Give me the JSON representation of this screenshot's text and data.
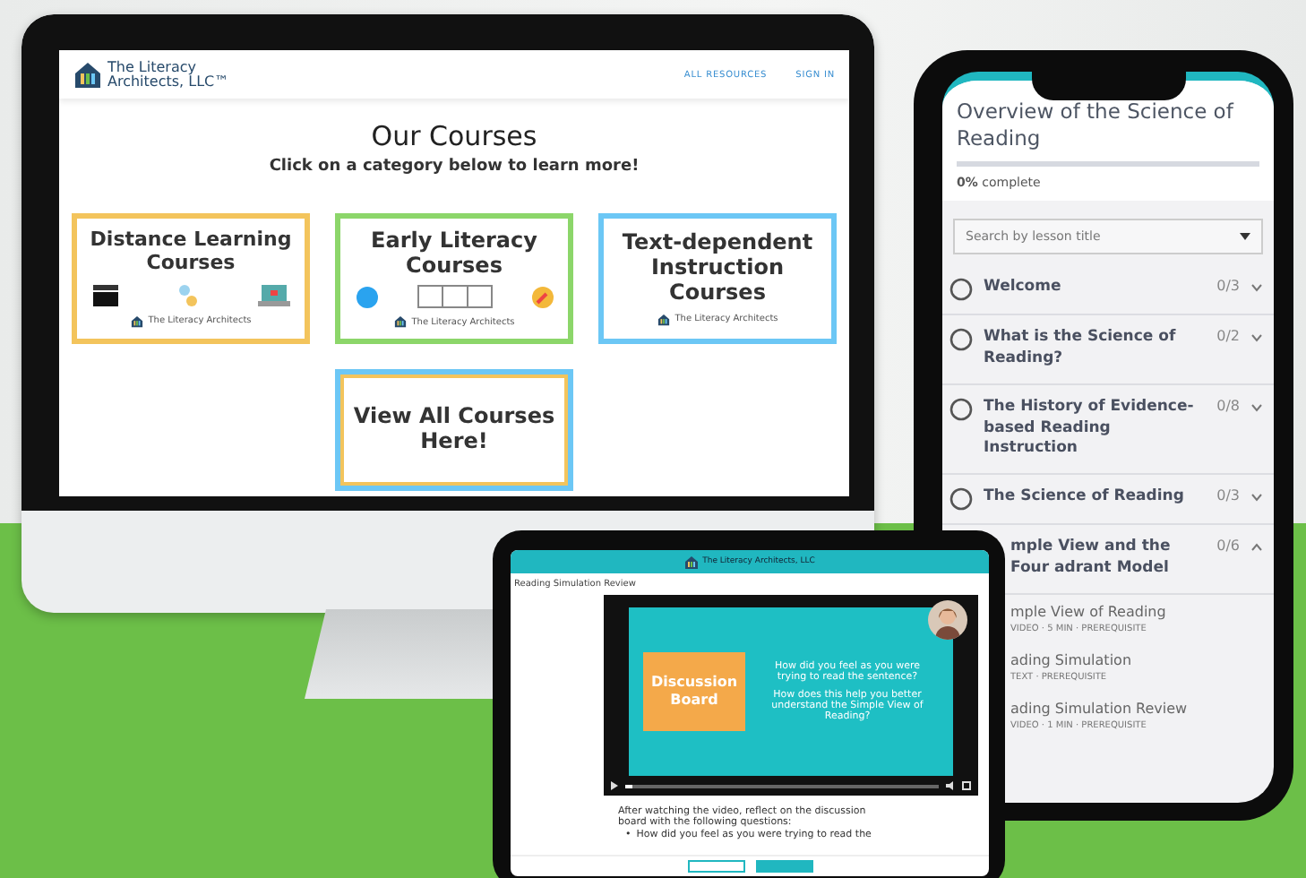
{
  "desktop": {
    "logo": "The Literacy Architects, LLC™",
    "nav": [
      {
        "label": "ALL RESOURCES"
      },
      {
        "label": "SIGN IN"
      }
    ],
    "heading": "Our Courses",
    "subheading": "Click on a category below to learn more!",
    "cards": [
      {
        "title": "Distance Learning Courses",
        "color": "#f3c45c",
        "kind": "distance",
        "footer": "The Literacy Architects"
      },
      {
        "title": "Early Literacy Courses",
        "color": "#8cd66a",
        "kind": "early",
        "footer": "The Literacy Architects"
      },
      {
        "title": "Text-dependent Instruction Courses",
        "color": "#6cc7f5",
        "kind": "text",
        "footer": "The Literacy Architects"
      },
      {
        "title": "View All Courses Here!",
        "color": "#6cc7f5",
        "kind": "all"
      }
    ]
  },
  "phone": {
    "title": "Overview of the Science of Reading",
    "progress": {
      "level": 0,
      "label": "**0%** complete"
    },
    "search": {
      "placeholder": "Search by lesson title"
    },
    "lessons": [
      {
        "kind": "full",
        "title": "Welcome",
        "count": "0/3",
        "expanded": false
      },
      {
        "kind": "full",
        "title": "What is the Science of Reading?",
        "count": "0/2",
        "expanded": false
      },
      {
        "kind": "full",
        "title": "The History of Evidence-based Reading Instruction",
        "count": "0/8",
        "expanded": false
      },
      {
        "kind": "full",
        "title": "The Science of Reading",
        "count": "0/3",
        "expanded": false
      },
      {
        "kind": "partial",
        "title": "mple View and the Four adrant Model",
        "count": "0/6",
        "expanded": true,
        "children": [
          {
            "title": "mple View of Reading",
            "meta": "VIDEO · 5 MIN · PREREQUISITE"
          },
          {
            "title": "ading Simulation",
            "meta": "TEXT · PREREQUISITE"
          },
          {
            "title": "ading Simulation Review",
            "meta": "VIDEO · 1 MIN · PREREQUISITE"
          }
        ]
      }
    ]
  },
  "tablet": {
    "logo": "The Literacy Architects, LLC",
    "breadcrumb": "Reading Simulation Review",
    "slide": {
      "board": "Discussion Board",
      "questions": [
        "How did you feel as you were trying to read the sentence?",
        "How does this help you better understand the Simple View of Reading?"
      ]
    },
    "video": {
      "level": 0.02
    },
    "prompt": "After watching the video, reflect on the discussion board with the following questions:",
    "bullet_mark": "•",
    "bullet": "How did you feel as you were trying to read the"
  }
}
